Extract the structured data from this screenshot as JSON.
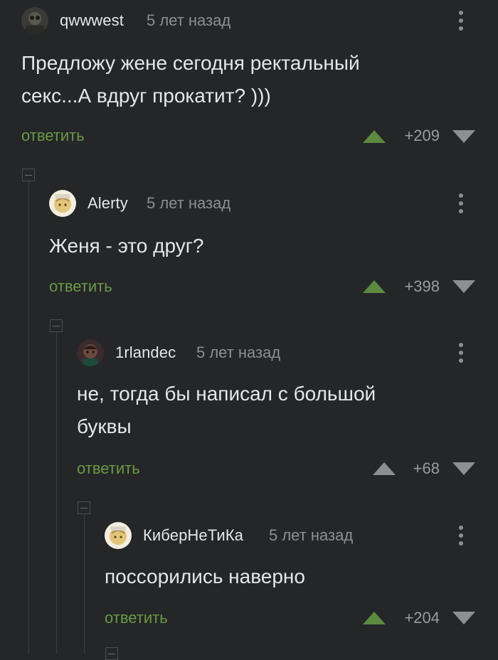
{
  "comments": [
    {
      "username": "qwwwest",
      "time": "5 лет назад",
      "text_lines": [
        "Предложу жене сегодня ректальный",
        "секс...А вдруг прокатит? )))"
      ],
      "reply_label": "ответить",
      "score": "+209"
    },
    {
      "username": "Alerty",
      "time": "5 лет назад",
      "text_lines": [
        "Женя - это друг?"
      ],
      "reply_label": "ответить",
      "score": "+398"
    },
    {
      "username": "1rlandec",
      "time": "5 лет назад",
      "text_lines": [
        "не, тогда бы написал с большой",
        "буквы"
      ],
      "reply_label": "ответить",
      "score": "+68"
    },
    {
      "username": "КиберНеТиКа",
      "time": "5 лет назад",
      "text_lines": [
        "поссорились наверно"
      ],
      "reply_label": "ответить",
      "score": "+204"
    }
  ],
  "colors": {
    "background": "#242628",
    "reply_green": "#6a9a43",
    "upvote_green": "#5c8a3e",
    "upvote_gray": "#8d9093",
    "downvote_gray": "#8d9093"
  },
  "icons": {
    "more": "three-dots-vertical-icon",
    "upvote": "triangle-up-icon",
    "downvote": "triangle-down-icon",
    "collapse": "collapse-minus-icon"
  }
}
